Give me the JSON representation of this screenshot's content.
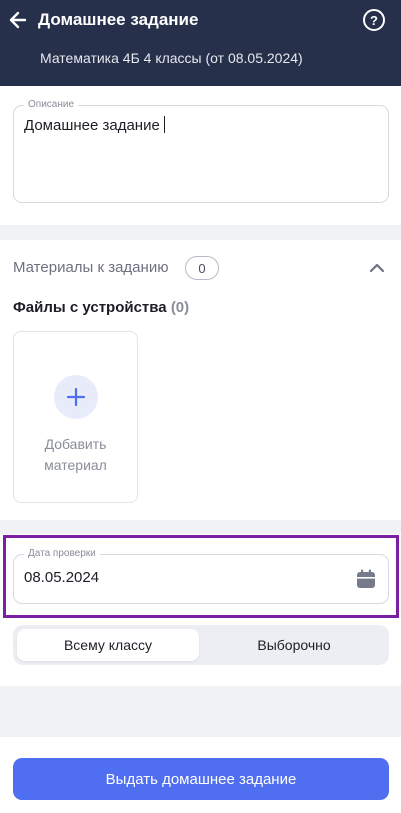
{
  "header": {
    "title": "Домашнее задание",
    "subtitle": "Математика 4Б 4 классы (от 08.05.2024)",
    "help_icon_glyph": "?"
  },
  "description": {
    "label": "Описание",
    "value": "Домашнее задание"
  },
  "materials": {
    "label": "Материалы к заданию",
    "count": "0",
    "files_title": "Файлы с устройства",
    "files_count": "(0)",
    "add_line1": "Добавить",
    "add_line2": "материал"
  },
  "review_date": {
    "label": "Дата проверки",
    "value": "08.05.2024"
  },
  "assign_to": {
    "options": [
      "Всему классу",
      "Выборочно"
    ],
    "selected": "Всему классу"
  },
  "submit_label": "Выдать домашнее задание",
  "colors": {
    "header_bg": "#27304a",
    "accent": "#4f6ef0",
    "highlight": "#7b1fa2",
    "page_bg": "#f1f2f6"
  },
  "icons": [
    "arrow-left-icon",
    "help-icon",
    "chevron-up-icon",
    "plus-icon",
    "calendar-icon"
  ]
}
